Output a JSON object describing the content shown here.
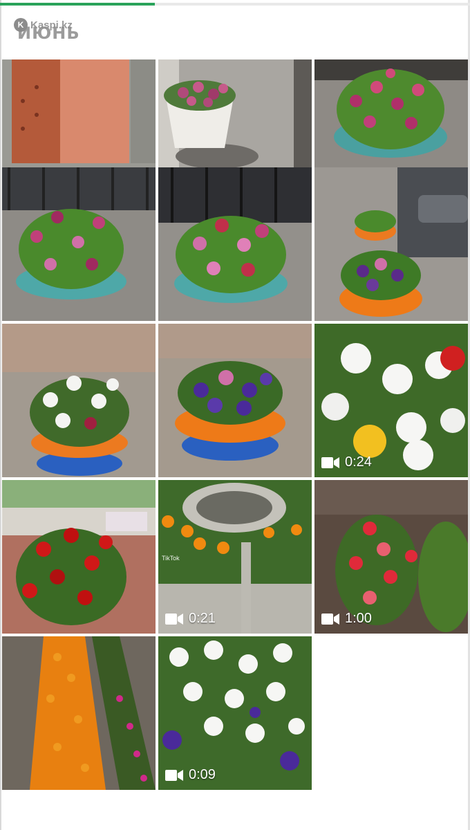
{
  "header": {
    "watermark_logo": "K",
    "watermark": "Kaspi.kz",
    "month": "ИЮНЬ"
  },
  "progress": {
    "fraction": 0.33
  },
  "tiles": [
    {
      "label": "photo",
      "duration": ""
    },
    {
      "label": "photo",
      "duration": ""
    },
    {
      "label": "photo",
      "duration": ""
    },
    {
      "label": "photo",
      "duration": ""
    },
    {
      "label": "photo",
      "duration": ""
    },
    {
      "label": "photo",
      "duration": ""
    },
    {
      "label": "photo",
      "duration": ""
    },
    {
      "label": "photo",
      "duration": ""
    },
    {
      "label": "video",
      "duration": "0:24"
    },
    {
      "label": "photo",
      "duration": ""
    },
    {
      "label": "video",
      "duration": "0:21",
      "overlay": "TikTok"
    },
    {
      "label": "video",
      "duration": "1:00"
    },
    {
      "label": "photo",
      "duration": ""
    },
    {
      "label": "video",
      "duration": "0:09"
    }
  ],
  "colors": {
    "accent": "#2aa35a",
    "background": "#ffffff"
  }
}
